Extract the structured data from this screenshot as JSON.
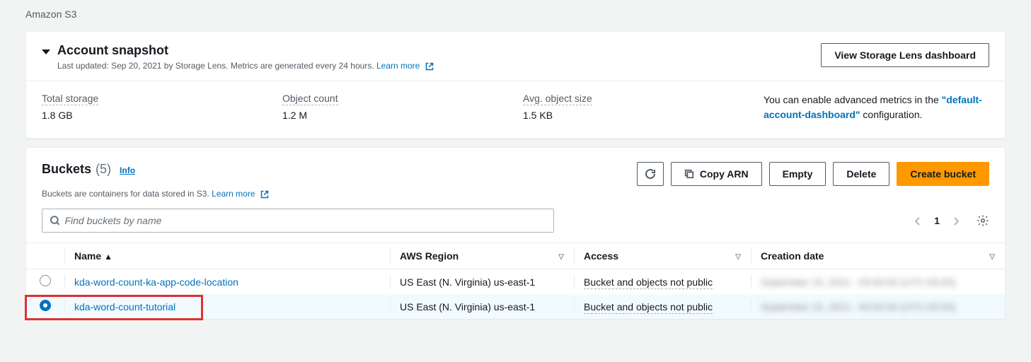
{
  "header": {
    "service": "Amazon S3"
  },
  "snapshot": {
    "title": "Account snapshot",
    "subtitle_prefix": "Last updated: Sep 20, 2021 by Storage Lens. Metrics are generated every 24 hours. ",
    "learn_more": "Learn more",
    "dashboard_btn": "View Storage Lens dashboard",
    "metrics": {
      "total_storage_label": "Total storage",
      "total_storage_value": "1.8 GB",
      "object_count_label": "Object count",
      "object_count_value": "1.2 M",
      "avg_size_label": "Avg. object size",
      "avg_size_value": "1.5 KB"
    },
    "hint_prefix": "You can enable advanced metrics in the ",
    "hint_link": "\"default-account-dashboard\"",
    "hint_suffix": " configuration."
  },
  "buckets": {
    "title": "Buckets",
    "count": "(5)",
    "info": "Info",
    "subtitle_prefix": "Buckets are containers for data stored in S3. ",
    "learn_more": "Learn more",
    "toolbar": {
      "copy_arn": "Copy ARN",
      "empty": "Empty",
      "delete": "Delete",
      "create": "Create bucket"
    },
    "search_placeholder": "Find buckets by name",
    "page": "1",
    "columns": {
      "name": "Name",
      "region": "AWS Region",
      "access": "Access",
      "created": "Creation date"
    },
    "rows": [
      {
        "selected": false,
        "name": "kda-word-count-ka-app-code-location",
        "region": "US East (N. Virginia) us-east-1",
        "access": "Bucket and objects not public",
        "created": "September 15, 2021 - 00:00:00 (UTC-05:00)"
      },
      {
        "selected": true,
        "name": "kda-word-count-tutorial",
        "region": "US East (N. Virginia) us-east-1",
        "access": "Bucket and objects not public",
        "created": "September 15, 2021 - 00:00:00 (UTC-05:00)"
      }
    ]
  }
}
